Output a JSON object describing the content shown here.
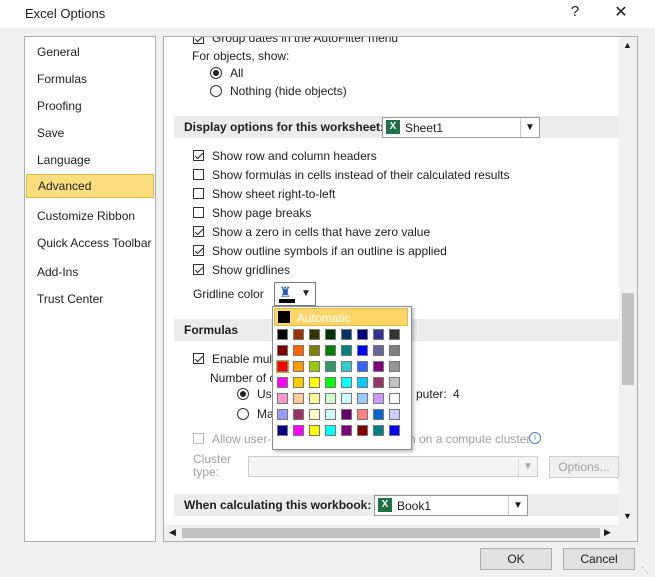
{
  "window": {
    "title": "Excel Options",
    "help": "?",
    "close": "✕"
  },
  "sidebar": {
    "items": [
      {
        "label": "General"
      },
      {
        "label": "Formulas"
      },
      {
        "label": "Proofing"
      },
      {
        "label": "Save"
      },
      {
        "label": "Language"
      },
      {
        "label": "Advanced",
        "active": true
      },
      {
        "label": "Customize Ribbon"
      },
      {
        "label": "Quick Access Toolbar"
      },
      {
        "label": "Add-Ins"
      },
      {
        "label": "Trust Center"
      }
    ]
  },
  "main": {
    "partial_option": "Group dates in the AutoFilter menu",
    "objects_label": "For objects, show:",
    "obj_all": "All",
    "obj_nothing": "Nothing (hide objects)",
    "worksheet_section": "Display options for this worksheet:",
    "worksheet_value": "Sheet1",
    "ws_options": [
      {
        "label": "Show row and column headers",
        "checked": true
      },
      {
        "label": "Show formulas in cells instead of their calculated results",
        "checked": false
      },
      {
        "label": "Show sheet right-to-left",
        "checked": false
      },
      {
        "label": "Show page breaks",
        "checked": false
      },
      {
        "label": "Show a zero in cells that have zero value",
        "checked": true
      },
      {
        "label": "Show outline symbols if an outline is applied",
        "checked": true
      },
      {
        "label": "Show gridlines",
        "checked": true
      }
    ],
    "gridline_color_label": "Gridline color",
    "formulas_section": "Formulas",
    "enable_multi": "Enable mult",
    "number_of": "Number of c",
    "use_label": "Use",
    "computer_suffix": "puter:",
    "computer_count": "4",
    "manual_label": "Ma",
    "allow_user": "Allow user-c",
    "compute_cluster": "n on a compute cluster",
    "cluster_type_label": "Cluster type:",
    "options_button": "Options...",
    "workbook_section": "When calculating this workbook:",
    "workbook_value": "Book1"
  },
  "color_picker": {
    "automatic_label": "Automatic",
    "swatches": [
      [
        "#000000",
        "#993300",
        "#333300",
        "#003300",
        "#003366",
        "#000080",
        "#333399",
        "#333333"
      ],
      [
        "#800000",
        "#ff6600",
        "#808000",
        "#008000",
        "#008080",
        "#0000ff",
        "#666699",
        "#808080"
      ],
      [
        "#ff0000",
        "#ff9900",
        "#99cc00",
        "#339966",
        "#33cccc",
        "#3366ff",
        "#800080",
        "#969696"
      ],
      [
        "#ff00ff",
        "#ffcc00",
        "#ffff00",
        "#00ff00",
        "#00ffff",
        "#00ccff",
        "#993366",
        "#c0c0c0"
      ],
      [
        "#ff99cc",
        "#ffcc99",
        "#ffff99",
        "#ccffcc",
        "#ccffff",
        "#99ccff",
        "#cc99ff",
        "#ffffff"
      ],
      [
        "#9999ff",
        "#993366",
        "#ffffcc",
        "#ccffff",
        "#660066",
        "#ff8080",
        "#0066cc",
        "#ccccff"
      ],
      [
        "#000080",
        "#ff00ff",
        "#ffff00",
        "#00ffff",
        "#800080",
        "#800000",
        "#008080",
        "#0000ff"
      ]
    ],
    "selected": "#ff0000"
  },
  "footer": {
    "ok": "OK",
    "cancel": "Cancel"
  }
}
